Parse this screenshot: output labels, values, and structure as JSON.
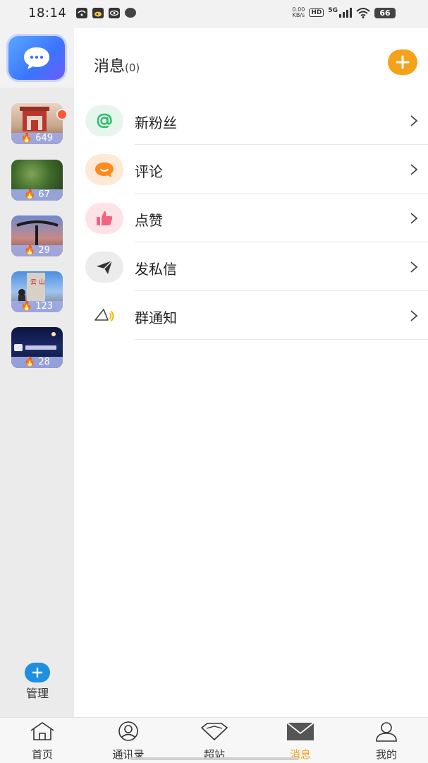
{
  "status_bar": {
    "time": "18:14",
    "net_speed_value": "0.00",
    "net_speed_unit": "KB/s",
    "hd_badge": "HD",
    "network_type": "5G",
    "battery": "66"
  },
  "header": {
    "title": "消息",
    "count": "(0)"
  },
  "sidebar": {
    "groups": [
      {
        "count": "649",
        "has_dot": true
      },
      {
        "count": "67",
        "has_dot": false
      },
      {
        "count": "29",
        "has_dot": false
      },
      {
        "count": "123",
        "has_dot": false
      },
      {
        "count": "28",
        "has_dot": false
      }
    ],
    "manage_label": "管理"
  },
  "message_items": [
    {
      "label": "新粉丝",
      "icon": "at-icon"
    },
    {
      "label": "评论",
      "icon": "comment-icon"
    },
    {
      "label": "点赞",
      "icon": "thumbs-up-icon"
    },
    {
      "label": "发私信",
      "icon": "send-icon"
    },
    {
      "label": "群通知",
      "icon": "horn-icon"
    }
  ],
  "bottom_nav": {
    "items": [
      {
        "label": "首页",
        "icon": "home-icon"
      },
      {
        "label": "通讯录",
        "icon": "contacts-icon"
      },
      {
        "label": "超站",
        "icon": "gem-icon"
      },
      {
        "label": "消息",
        "icon": "mail-icon",
        "active": true
      },
      {
        "label": "我的",
        "icon": "profile-icon"
      }
    ]
  },
  "colors": {
    "accent": "#f5a21b",
    "app_tile": "#3a74ff",
    "notification_dot": "#ff5533",
    "manage_button": "#1f8fe0"
  }
}
